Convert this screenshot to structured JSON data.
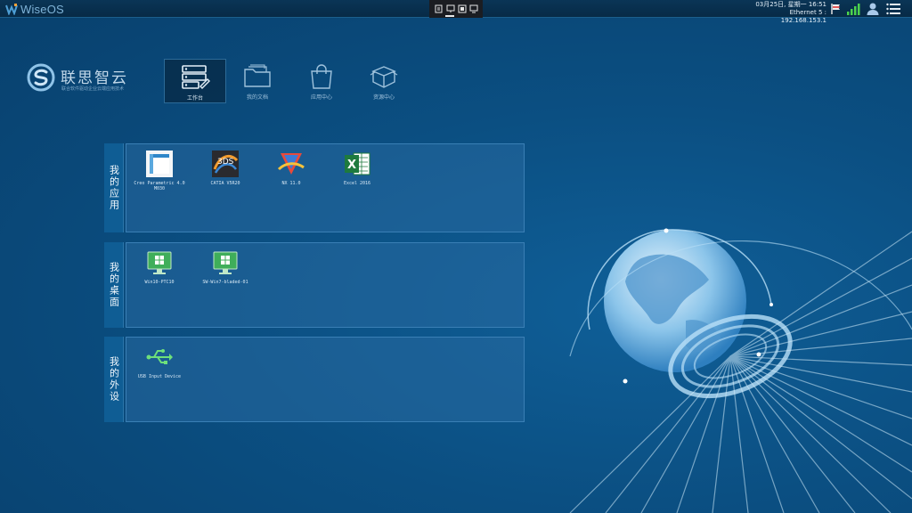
{
  "topbar": {
    "os_name": "WiseOS",
    "clock_line1": "03月25日, 星期一 16:51",
    "clock_line2": "Ethernet 5 : 192.168.153.1"
  },
  "brand": {
    "title": "联思智云",
    "subtitle": "联合软件驱动企业云端应用技术"
  },
  "nav": [
    {
      "label": "工作台",
      "icon": "workbench-icon",
      "active": true
    },
    {
      "label": "我的文档",
      "icon": "folder-icon",
      "active": false
    },
    {
      "label": "应用中心",
      "icon": "shopping-bag-icon",
      "active": false
    },
    {
      "label": "资源中心",
      "icon": "box-icon",
      "active": false
    }
  ],
  "panels": {
    "apps": {
      "label": "我的应用",
      "items": [
        {
          "label": "Creo Parametric 4.0 M030",
          "icon": "creo-icon"
        },
        {
          "label": "CATIA V5R20",
          "icon": "catia-icon"
        },
        {
          "label": "NX 11.0",
          "icon": "nx-icon"
        },
        {
          "label": "Excel 2016",
          "icon": "excel-icon"
        }
      ]
    },
    "desktops": {
      "label": "我的桌面",
      "items": [
        {
          "label": "Win10-PTC10",
          "icon": "windows-desktop-icon"
        },
        {
          "label": "SW-Win7-bladed-01",
          "icon": "windows-desktop-icon"
        }
      ]
    },
    "devices": {
      "label": "我的外设",
      "items": [
        {
          "label": "USB Input Device",
          "icon": "usb-icon"
        }
      ]
    }
  },
  "colors": {
    "background": "#0b4f82",
    "panel_body": "#2869a0",
    "panel_side": "#0f5d94",
    "excel_green": "#1e7a3e",
    "desktop_green": "#3fae5a"
  }
}
